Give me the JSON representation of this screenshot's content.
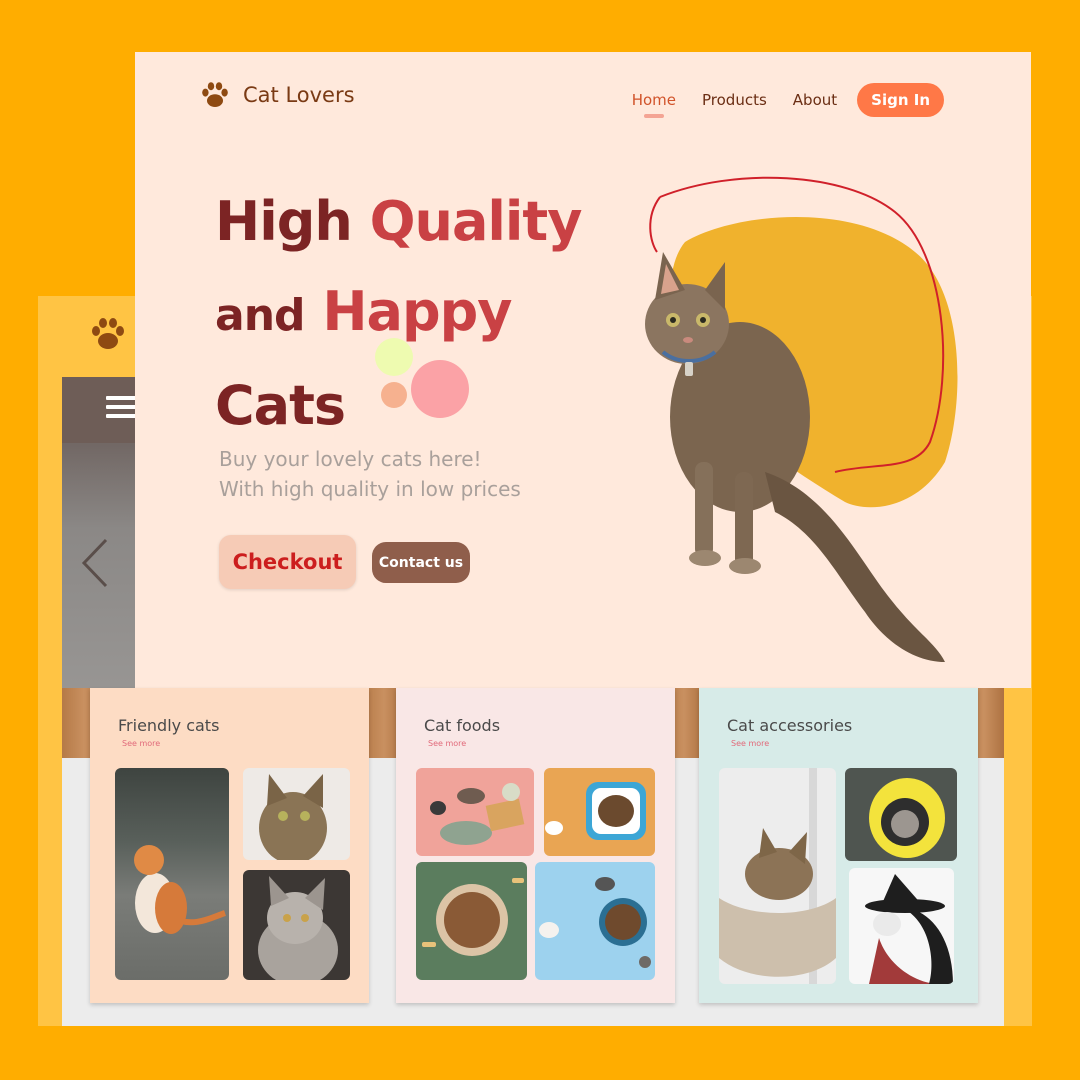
{
  "brand": {
    "name": "Cat Lovers",
    "paw_color": "#8E4A12"
  },
  "nav": {
    "items": [
      {
        "label": "Home",
        "active": true
      },
      {
        "label": "Products",
        "active": false
      },
      {
        "label": "About",
        "active": false
      }
    ],
    "signin_label": "Sign In"
  },
  "hero": {
    "line1_a": "High",
    "line1_b": "Quality",
    "line2_a": "and",
    "line2_b": "Happy",
    "line3": "Cats",
    "sub1": "Buy your lovely cats here!",
    "sub2": "With high quality in low prices",
    "checkout_label": "Checkout",
    "contact_label": "Contact us"
  },
  "cards": [
    {
      "title": "Friendly cats",
      "link": "See more",
      "bg": "#FDDCC4"
    },
    {
      "title": "Cat foods",
      "link": "See more",
      "bg": "#F9E7E6"
    },
    {
      "title": "Cat accessories",
      "link": "See more",
      "bg": "#D7EBE8"
    }
  ],
  "colors": {
    "background": "#FFAD00",
    "page": "#FFE9DC",
    "headline": "#7C2424",
    "accent": "#C94144",
    "signin": "#FF7847",
    "blob": "#F0B22D"
  }
}
